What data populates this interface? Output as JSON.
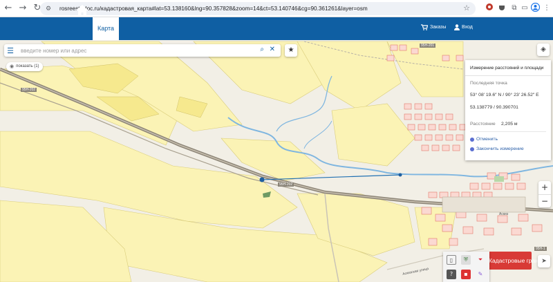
{
  "browser": {
    "nav_icons": [
      "arrow-left-icon",
      "arrow-right-icon",
      "reload-icon"
    ],
    "url": "rosreestr-doc.ru/кадастровая_карта#lat=53.138160&lng=90.357828&zoom=14&ct=53.140746&cg=90.361261&layer=osm"
  },
  "header": {
    "brand_color": "#0f5fa3",
    "map_tab": "Карта",
    "orders": "Заказы",
    "login": "Вход"
  },
  "search": {
    "placeholder": "введите номер или адрес"
  },
  "show_button": "показать (1)",
  "map_labels": {
    "road1": "95Н-202",
    "road2": "95Н-202",
    "road3": "95Н-201",
    "road4": "95Н-1",
    "station": "Аскиз",
    "street": "Аскизская улица"
  },
  "measure": {
    "title": "Измерение расстояний и площади",
    "last_point_label": "Последняя точка",
    "dms": "53° 08′ 19.6″ N / 90° 23′ 26.52″ E",
    "decimal": "53.138779 / 90.390701",
    "distance_label": "Расстояние",
    "distance_value": "2,205 м",
    "cancel": "Отменить",
    "finish": "Закончить измерение"
  },
  "red_button": "Кадастровые границы",
  "zoom": {
    "in": "+",
    "out": "−"
  }
}
